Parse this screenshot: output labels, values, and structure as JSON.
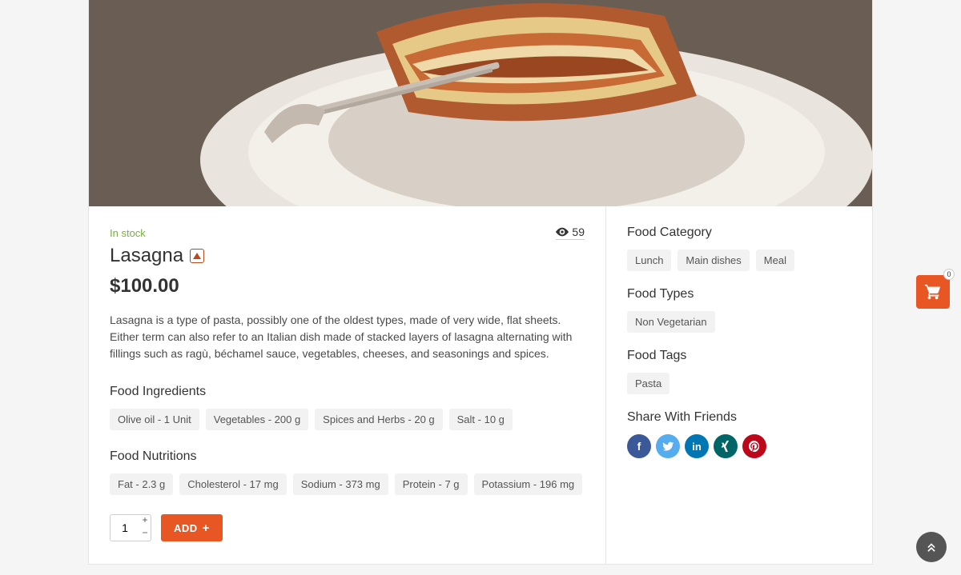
{
  "stock_label": "In stock",
  "views": "59",
  "product": {
    "title": "Lasagna",
    "price": "$100.00",
    "description": "Lasagna is a type of pasta, possibly one of the oldest types, made of very wide, flat sheets. Either term can also refer to an Italian dish made of stacked layers of lasagna alternating with fillings such as ragù, béchamel sauce, vegetables, cheeses, and seasonings and spices."
  },
  "sections": {
    "ingredients_header": "Food Ingredients",
    "ingredients": [
      "Olive oil - 1 Unit",
      "Vegetables - 200 g",
      "Spices and Herbs - 20 g",
      "Salt - 10 g"
    ],
    "nutritions_header": "Food Nutritions",
    "nutritions": [
      "Fat - 2.3 g",
      "Cholesterol - 17 mg",
      "Sodium - 373 mg",
      "Protein - 7 g",
      "Potassium - 196 mg"
    ]
  },
  "actions": {
    "quantity": "1",
    "add_label": "ADD"
  },
  "sidebar": {
    "category_header": "Food Category",
    "categories": [
      "Lunch",
      "Main dishes",
      "Meal"
    ],
    "types_header": "Food Types",
    "types": [
      "Non Vegetarian"
    ],
    "tags_header": "Food Tags",
    "tags": [
      "Pasta"
    ],
    "share_header": "Share With Friends"
  },
  "cart": {
    "count": "0"
  }
}
